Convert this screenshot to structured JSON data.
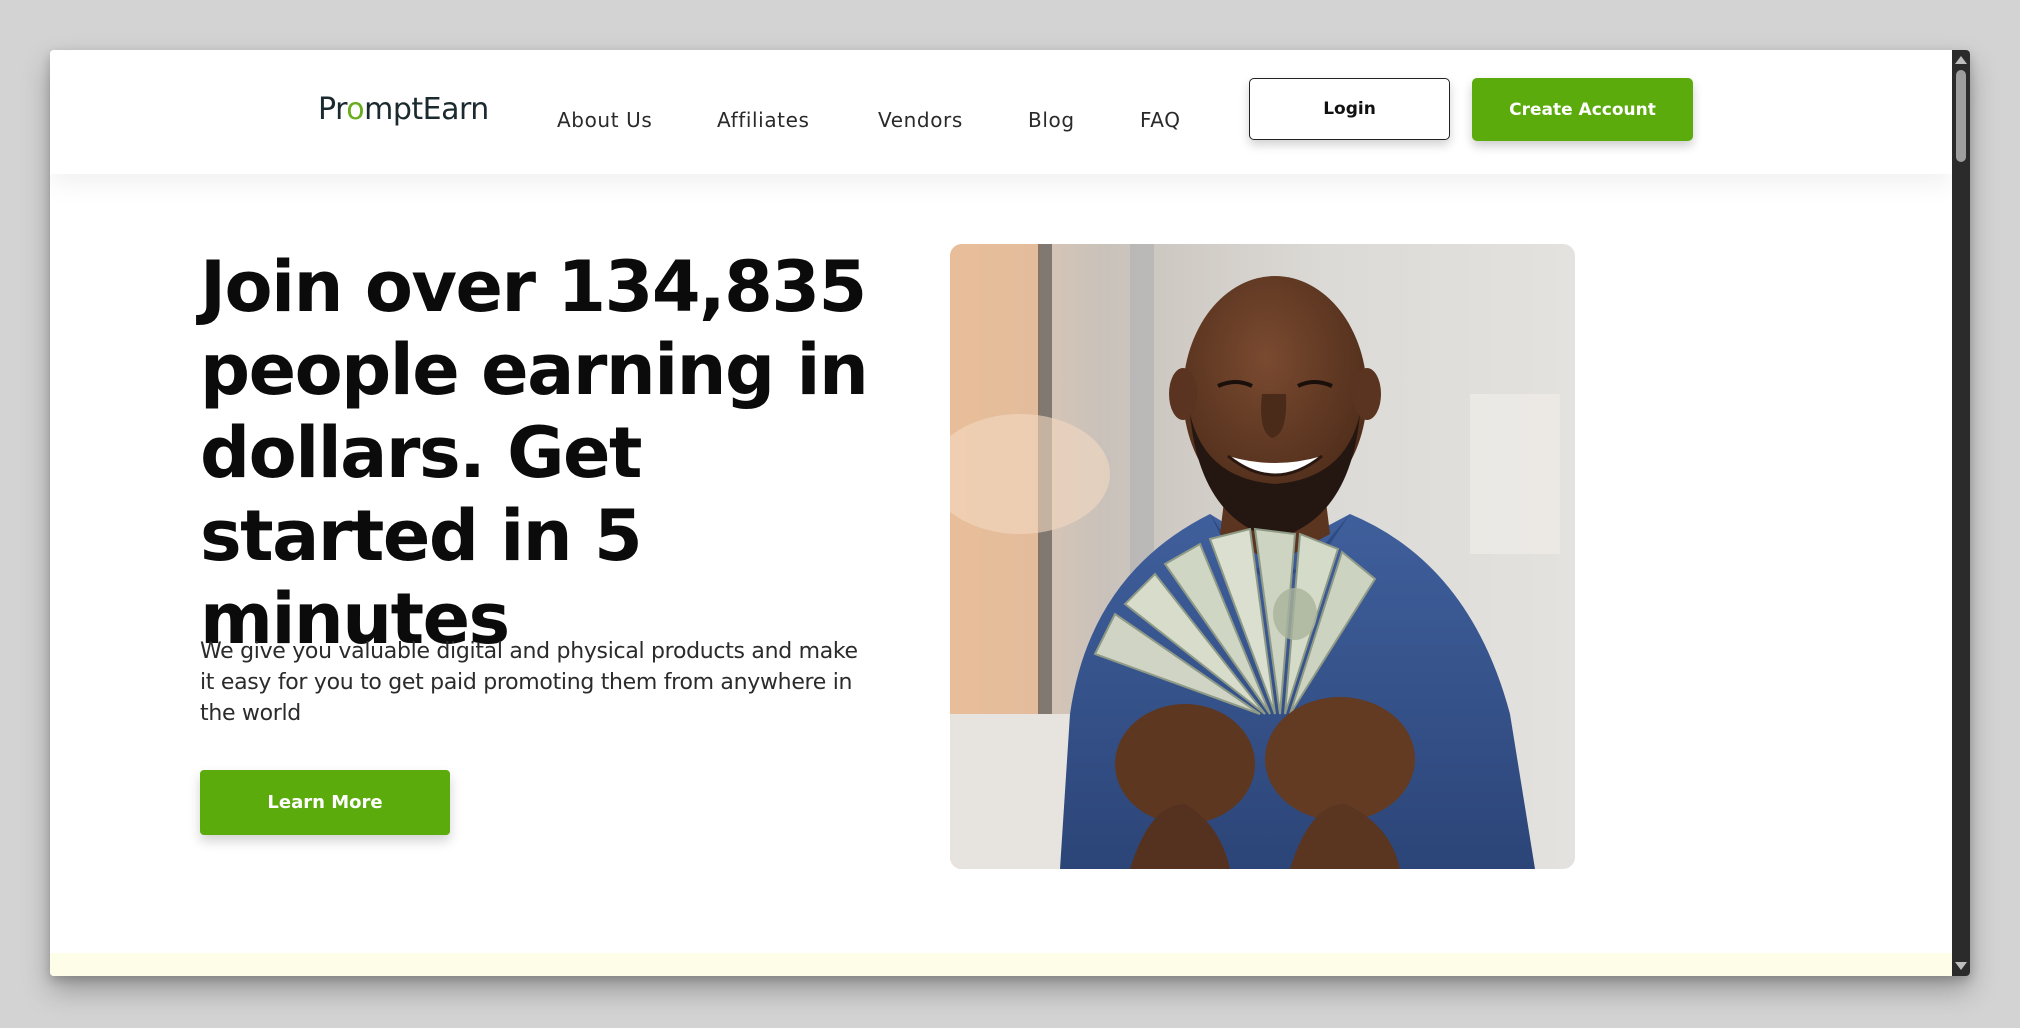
{
  "header": {
    "logo": {
      "prefix": "Pr",
      "accent": "o",
      "suffix": "mptEarn"
    },
    "nav": [
      {
        "label": "About Us"
      },
      {
        "label": "Affiliates"
      },
      {
        "label": "Vendors"
      },
      {
        "label": "Blog"
      },
      {
        "label": "FAQ"
      }
    ],
    "login_label": "Login",
    "create_account_label": "Create Account"
  },
  "hero": {
    "title": "Join over 134,835 people earning in dollars. Get started in 5 minutes",
    "subtitle": "We give you valuable digital and physical products and make it easy for you to get paid promoting them from anywhere in the world",
    "cta_label": "Learn More",
    "image_subject": "smiling man holding a fan of dollar bills"
  },
  "colors": {
    "brand_green": "#5aab0b",
    "logo_accent": "#6aad1c",
    "text_dark": "#0b0b0b",
    "bottom_band": "#fdfde8",
    "page_background": "#d3d3d3"
  },
  "icons": {
    "scroll_up": "triangle-up-icon",
    "scroll_down": "triangle-down-icon"
  }
}
